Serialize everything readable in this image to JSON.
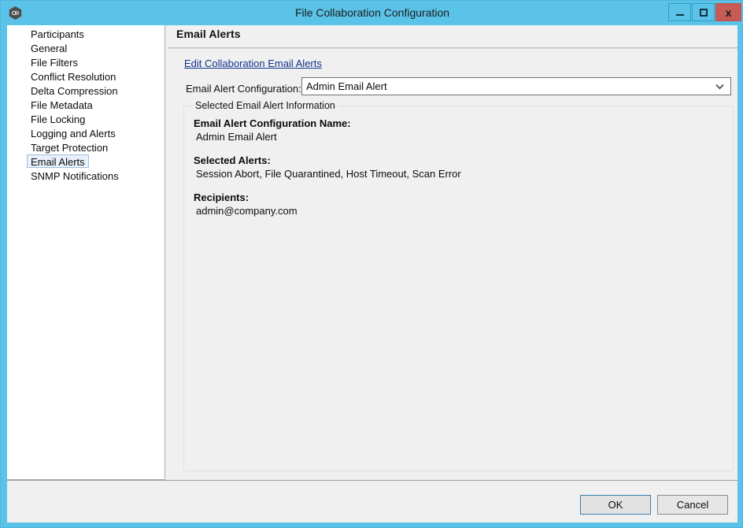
{
  "window": {
    "title": "File Collaboration Configuration",
    "icon": "app-hexagon-icon",
    "controls": {
      "minimize": "–",
      "maximize": "□",
      "close": "x"
    },
    "frame_color": "#5BC3E8",
    "close_color": "#C75B56"
  },
  "sidebar": {
    "items": [
      {
        "label": "Participants",
        "selected": false
      },
      {
        "label": "General",
        "selected": false
      },
      {
        "label": "File Filters",
        "selected": false
      },
      {
        "label": "Conflict Resolution",
        "selected": false
      },
      {
        "label": "Delta Compression",
        "selected": false
      },
      {
        "label": "File Metadata",
        "selected": false
      },
      {
        "label": "File Locking",
        "selected": false
      },
      {
        "label": "Logging and Alerts",
        "selected": false
      },
      {
        "label": "Target Protection",
        "selected": false
      },
      {
        "label": "Email Alerts",
        "selected": true
      },
      {
        "label": "SNMP Notifications",
        "selected": false
      }
    ],
    "selection_color": "#E8F0FB"
  },
  "pane": {
    "title": "Email Alerts",
    "edit_link": "Edit Collaboration Email Alerts",
    "link_color": "#13328C",
    "combo": {
      "label": "Email Alert Configuration:",
      "value": "Admin Email Alert",
      "arrow_icon": "chevron-down-icon",
      "options": [
        "Admin Email Alert"
      ]
    },
    "group": {
      "legend": "Selected Email Alert Information",
      "fields": [
        {
          "label": "Email Alert Configuration Name:",
          "value": "Admin Email Alert"
        },
        {
          "label": "Selected Alerts:",
          "value": "Session Abort, File Quarantined, Host Timeout, Scan Error"
        },
        {
          "label": "Recipients:",
          "value": "admin@company.com"
        }
      ]
    }
  },
  "footer": {
    "ok_label": "OK",
    "cancel_label": "Cancel"
  }
}
